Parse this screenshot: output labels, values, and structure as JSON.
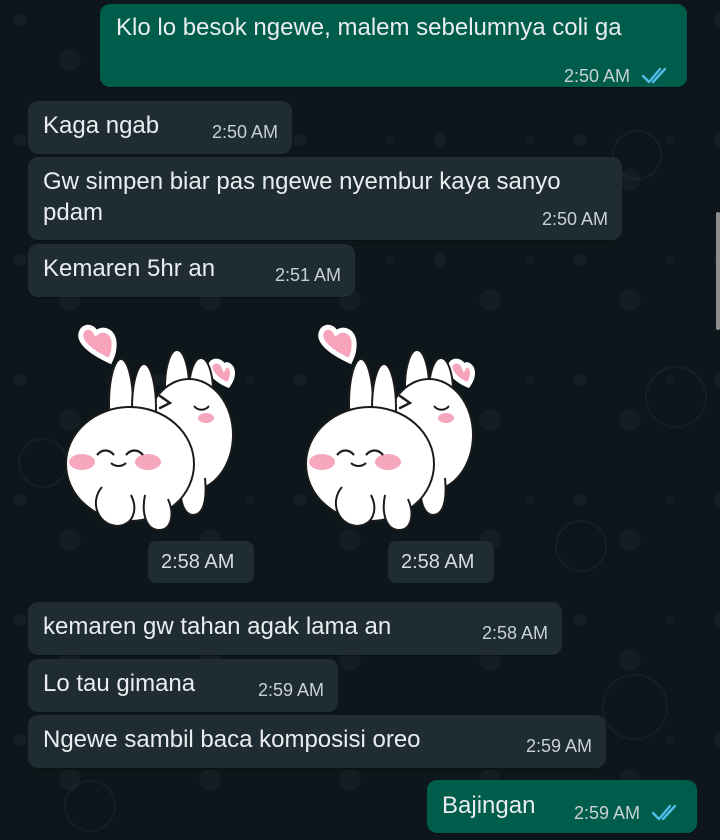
{
  "chat": {
    "messages": [
      {
        "direction": "outgoing",
        "text": "Klo lo besok ngewe, malem sebelumnya coli ga",
        "time": "2:50 AM",
        "status": "read"
      },
      {
        "direction": "incoming",
        "text": "Kaga ngab",
        "time": "2:50 AM"
      },
      {
        "direction": "incoming",
        "text": "Gw simpen biar pas ngewe nyembur kaya sanyo pdam",
        "time": "2:50 AM"
      },
      {
        "direction": "incoming",
        "text": "Kemaren 5hr an",
        "time": "2:51 AM"
      },
      {
        "direction": "incoming",
        "type": "sticker",
        "sticker_icon": "bunny-hug-sticker",
        "time": "2:58 AM"
      },
      {
        "direction": "incoming",
        "type": "sticker",
        "sticker_icon": "bunny-hug-sticker",
        "time": "2:58 AM"
      },
      {
        "direction": "incoming",
        "text": "kemaren gw tahan agak lama an",
        "time": "2:58 AM"
      },
      {
        "direction": "incoming",
        "text": "Lo tau gimana",
        "time": "2:59 AM"
      },
      {
        "direction": "incoming",
        "text": "Ngewe sambil baca komposisi oreo",
        "time": "2:59 AM"
      },
      {
        "direction": "outgoing",
        "text": "Bajingan",
        "time": "2:59 AM",
        "status": "read"
      }
    ]
  },
  "colors": {
    "background": "#0b141a",
    "incoming_bubble": "#1f2c34",
    "outgoing_bubble": "#005c4b",
    "read_ticks": "#53bdeb"
  }
}
